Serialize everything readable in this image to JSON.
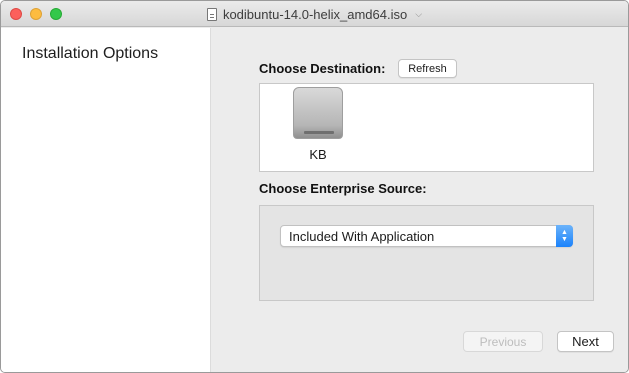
{
  "window": {
    "title": "kodibuntu-14.0-helix_amd64.iso",
    "title_icon": "document-icon",
    "menu_chevron": "⌵"
  },
  "sidebar": {
    "title": "Installation Options"
  },
  "destination": {
    "label": "Choose Destination:",
    "refresh_label": "Refresh",
    "drives": [
      {
        "label": "KB",
        "icon": "hard-drive-icon"
      }
    ]
  },
  "enterprise": {
    "label": "Choose Enterprise Source:",
    "selected": "Included With Application",
    "stepper_up": "▲",
    "stepper_down": "▼"
  },
  "footer": {
    "previous_label": "Previous",
    "next_label": "Next"
  },
  "colors": {
    "close": "#fc605c",
    "minimize": "#fdbc40",
    "zoom": "#34c84a",
    "accent": "#1a82fb"
  }
}
